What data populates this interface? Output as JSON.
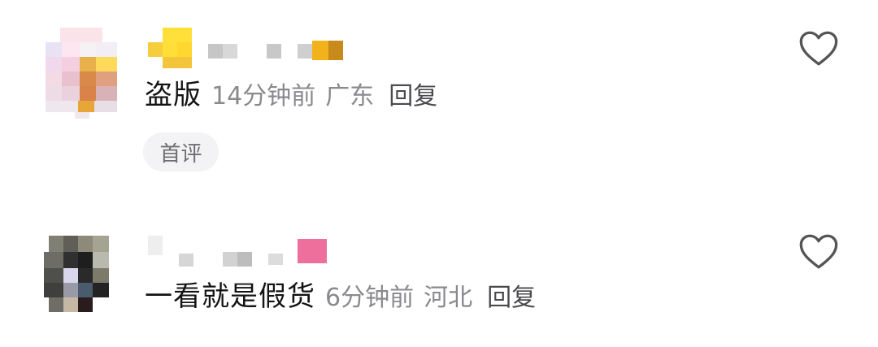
{
  "comments": [
    {
      "text": "盗版",
      "time": "14分钟前",
      "location": "广东",
      "reply_label": "回复",
      "badge": "首评",
      "like_icon": "heart-outline-icon"
    },
    {
      "text": "一看就是假货",
      "time": "6分钟前",
      "location": "河北",
      "reply_label": "回复",
      "like_icon": "heart-outline-icon"
    }
  ],
  "colors": {
    "primary_text": "#141414",
    "secondary_text": "#8a8a8e",
    "reply_text": "#4a4a4e",
    "badge_bg": "#f3f3f5",
    "icon_stroke": "#555555"
  }
}
